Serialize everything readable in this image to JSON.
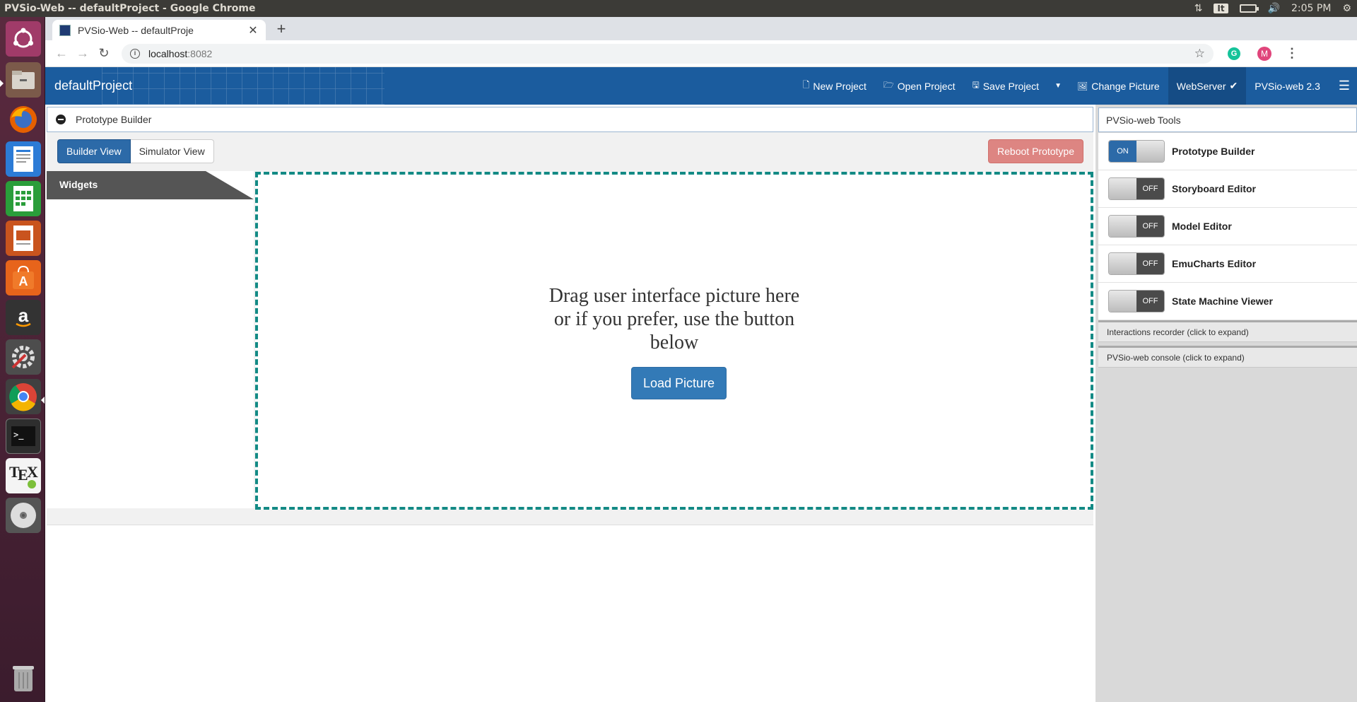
{
  "os": {
    "window_title": "PVSio-Web -- defaultProject - Google Chrome",
    "keyboard": "It",
    "time": "2:05 PM"
  },
  "launcher": {
    "items": [
      "ubuntu-dash",
      "files",
      "firefox",
      "writer",
      "calc",
      "impress",
      "software-center",
      "amazon",
      "system-settings",
      "chrome",
      "terminal",
      "texmaker",
      "dvd",
      "trash"
    ]
  },
  "browser": {
    "tab_title": "PVSio-Web -- defaultProje",
    "url_host": "localhost",
    "url_port": ":8082",
    "profile_initial": "M",
    "ext_initial": "G"
  },
  "navbar": {
    "brand": "defaultProject",
    "new_project": "New Project",
    "open_project": "Open Project",
    "save_project": "Save Project",
    "change_picture": "Change Picture",
    "webserver": "WebServer",
    "webserver_check": "✔",
    "version": "PVSio-web 2.3"
  },
  "builder": {
    "title": "Prototype Builder",
    "builder_view": "Builder View",
    "simulator_view": "Simulator View",
    "reboot": "Reboot Prototype",
    "widgets": "Widgets",
    "drop_line1": "Drag user interface picture here",
    "drop_line2": "or if you prefer, use the button",
    "drop_line3": "below",
    "load_picture": "Load Picture"
  },
  "tools": {
    "title": "PVSio-web Tools",
    "items": [
      {
        "label": "Prototype Builder",
        "state": "ON"
      },
      {
        "label": "Storyboard Editor",
        "state": "OFF"
      },
      {
        "label": "Model Editor",
        "state": "OFF"
      },
      {
        "label": "EmuCharts Editor",
        "state": "OFF"
      },
      {
        "label": "State Machine Viewer",
        "state": "OFF"
      }
    ],
    "interactions": "Interactions recorder (click to expand)",
    "console": "PVSio-web console (click to expand)"
  },
  "colors": {
    "navbar": "#1b5c9e",
    "primary_button": "#337ab7",
    "reboot_button": "#dd8582",
    "drop_border": "#138a85"
  }
}
